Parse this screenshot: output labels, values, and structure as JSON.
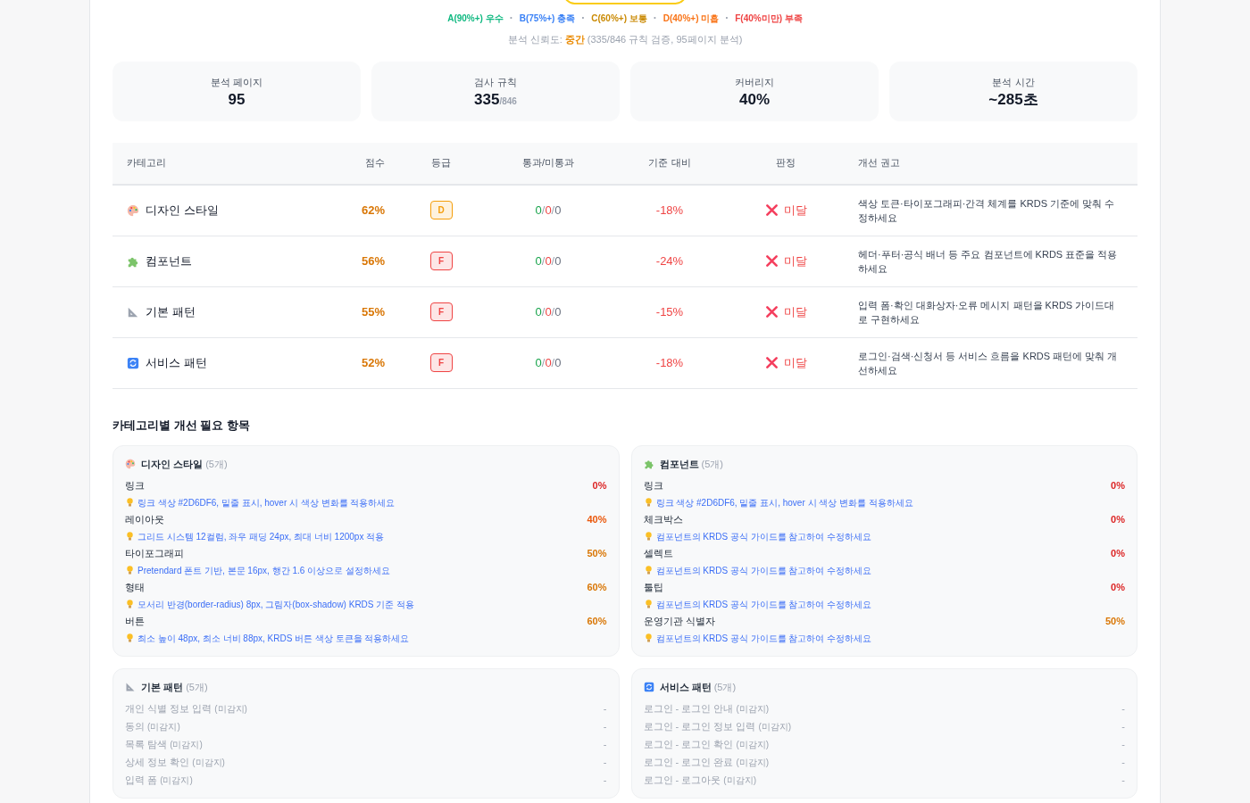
{
  "legend_separator": "·",
  "legend": [
    {
      "label": "A(90%+) 우수",
      "color": "#10b981"
    },
    {
      "label": "B(75%+) 충족",
      "color": "#3b82f6"
    },
    {
      "label": "C(60%+) 보통",
      "color": "#ca8a04"
    },
    {
      "label": "D(40%+) 미흡",
      "color": "#f97316"
    },
    {
      "label": "F(40%미만) 부족",
      "color": "#ef4444"
    }
  ],
  "confidence": {
    "label": "분석 신뢰도:",
    "value": "중간",
    "detail": "(335/846 규칙 검증, 95페이지 분석)"
  },
  "stats": [
    {
      "label": "분석 페이지",
      "value": "95"
    },
    {
      "label": "검사 규칙",
      "value": "335",
      "total": "/846"
    },
    {
      "label": "커버리지",
      "value": "40%"
    },
    {
      "label": "분석 시간",
      "value": "~285초"
    }
  ],
  "table": {
    "count_separator": "/",
    "columns": [
      "카테고리",
      "점수",
      "등급",
      "통과/미통과",
      "기준 대비",
      "판정",
      "개선 권고"
    ],
    "rows": [
      {
        "kind": "design",
        "category": "디자인 스타일",
        "score": "62%",
        "grade": {
          "label": "D",
          "color": "#f59e0b"
        },
        "pass": "0",
        "fail": "0",
        "other": "0",
        "delta": "-18%",
        "passed": false,
        "verdict": "미달",
        "recommendation": "색상 토큰·타이포그래피·간격 체계를 KRDS 기준에 맞춰 수정하세요"
      },
      {
        "kind": "component",
        "category": "컴포넌트",
        "score": "56%",
        "grade": {
          "label": "F",
          "color": "#ef4444"
        },
        "pass": "0",
        "fail": "0",
        "other": "0",
        "delta": "-24%",
        "passed": false,
        "verdict": "미달",
        "recommendation": "헤더·푸터·공식 배너 등 주요 컴포넌트에 KRDS 표준을 적용하세요"
      },
      {
        "kind": "basic",
        "category": "기본 패턴",
        "score": "55%",
        "grade": {
          "label": "F",
          "color": "#ef4444"
        },
        "pass": "0",
        "fail": "0",
        "other": "0",
        "delta": "-15%",
        "passed": false,
        "verdict": "미달",
        "recommendation": "입력 폼·확인 대화상자·오류 메시지 패턴을 KRDS 가이드대로 구현하세요"
      },
      {
        "kind": "service",
        "category": "서비스 패턴",
        "score": "52%",
        "grade": {
          "label": "F",
          "color": "#ef4444"
        },
        "pass": "0",
        "fail": "0",
        "other": "0",
        "delta": "-18%",
        "passed": false,
        "verdict": "미달",
        "recommendation": "로그인·검색·신청서 등 서비스 흐름을 KRDS 패턴에 맞춰 개선하세요"
      }
    ]
  },
  "improvements": {
    "title": "카테고리별 개선 필요 항목",
    "cards": [
      {
        "kind": "design",
        "title": "디자인 스타일",
        "count": "(5개)",
        "items": [
          {
            "name": "링크",
            "score": "0%",
            "color": "#dc2626",
            "detected": true,
            "tip": "링크 색상 #2D6DF6, 밑줄 표시, hover 시 색상 변화를 적용하세요"
          },
          {
            "name": "레이아웃",
            "score": "40%",
            "color": "#ea580c",
            "detected": true,
            "tip": "그리드 시스템 12컬럼, 좌우 패딩 24px, 최대 너비 1200px 적용"
          },
          {
            "name": "타이포그래피",
            "score": "50%",
            "color": "#d97706",
            "detected": true,
            "tip": "Pretendard 폰트 기반, 본문 16px, 행간 1.6 이상으로 설정하세요"
          },
          {
            "name": "형태",
            "score": "60%",
            "color": "#d97706",
            "detected": true,
            "tip": "모서리 반경(border-radius) 8px, 그림자(box-shadow) KRDS 기준 적용"
          },
          {
            "name": "버튼",
            "score": "60%",
            "color": "#d97706",
            "detected": true,
            "tip": "최소 높이 48px, 최소 너비 88px, KRDS 버튼 색상 토큰을 적용하세요"
          }
        ]
      },
      {
        "kind": "component",
        "title": "컴포넌트",
        "count": "(5개)",
        "items": [
          {
            "name": "링크",
            "score": "0%",
            "color": "#dc2626",
            "detected": true,
            "tip": "링크 색상 #2D6DF6, 밑줄 표시, hover 시 색상 변화를 적용하세요"
          },
          {
            "name": "체크박스",
            "score": "0%",
            "color": "#dc2626",
            "detected": true,
            "tip": "컴포넌트의 KRDS 공식 가이드를 참고하여 수정하세요"
          },
          {
            "name": "셀렉트",
            "score": "0%",
            "color": "#dc2626",
            "detected": true,
            "tip": "컴포넌트의 KRDS 공식 가이드를 참고하여 수정하세요"
          },
          {
            "name": "툴팁",
            "score": "0%",
            "color": "#dc2626",
            "detected": true,
            "tip": "컴포넌트의 KRDS 공식 가이드를 참고하여 수정하세요"
          },
          {
            "name": "운영기관 식별자",
            "score": "50%",
            "color": "#d97706",
            "detected": true,
            "tip": "컴포넌트의 KRDS 공식 가이드를 참고하여 수정하세요"
          }
        ]
      },
      {
        "kind": "basic",
        "title": "기본 패턴",
        "count": "(5개)",
        "items": [
          {
            "name": "개인 식별 정보 입력",
            "note": "(미감지)",
            "score": "-",
            "detected": false
          },
          {
            "name": "동의",
            "note": "(미감지)",
            "score": "-",
            "detected": false
          },
          {
            "name": "목록 탐색",
            "note": "(미감지)",
            "score": "-",
            "detected": false
          },
          {
            "name": "상세 정보 확인",
            "note": "(미감지)",
            "score": "-",
            "detected": false
          },
          {
            "name": "입력 폼",
            "note": "(미감지)",
            "score": "-",
            "detected": false
          }
        ]
      },
      {
        "kind": "service",
        "title": "서비스 패턴",
        "count": "(5개)",
        "items": [
          {
            "name": "로그인 - 로그인 안내",
            "note": "(미감지)",
            "score": "-",
            "detected": false
          },
          {
            "name": "로그인 - 로그인 정보 입력",
            "note": "(미감지)",
            "score": "-",
            "detected": false
          },
          {
            "name": "로그인 - 로그인 확인",
            "note": "(미감지)",
            "score": "-",
            "detected": false
          },
          {
            "name": "로그인 - 로그인 완료",
            "note": "(미감지)",
            "score": "-",
            "detected": false
          },
          {
            "name": "로그인 - 로그아웃",
            "note": "(미감지)",
            "score": "-",
            "detected": false
          }
        ]
      }
    ]
  }
}
